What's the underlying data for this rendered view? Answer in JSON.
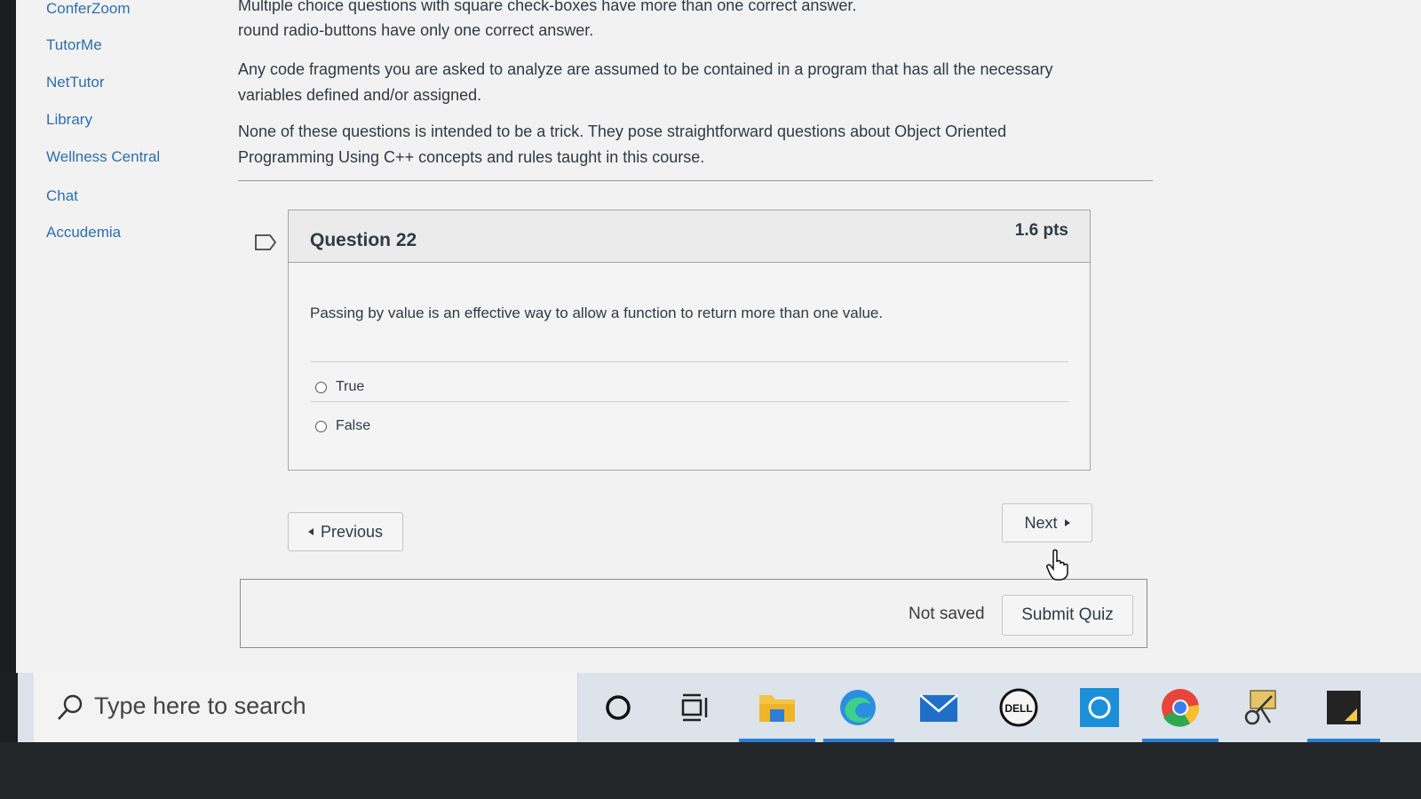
{
  "sidebar": {
    "items": [
      "ConferZoom",
      "TutorMe",
      "NetTutor",
      "Library",
      "Wellness Central",
      "Chat",
      "Accudemia"
    ]
  },
  "intro": {
    "para1_line1": "Multiple choice questions with square check-boxes have more than one correct answer.",
    "para1_line2": "round radio-buttons have only one correct answer.",
    "para2_line1": "Any code fragments you are asked to analyze are assumed to be contained in a program that has all the necessary",
    "para2_line2": "variables defined and/or assigned.",
    "para3_line1": "None of these questions is intended to be a trick.  They pose straightforward questions about Object Oriented",
    "para3_line2": "Programming Using C++  concepts and rules taught in this course."
  },
  "question": {
    "title": "Question 22",
    "points": "1.6 pts",
    "text": "Passing by value is an effective way to allow a function to return more than one value.",
    "answers": [
      "True",
      "False"
    ]
  },
  "nav": {
    "previous_label": "Previous",
    "next_label": "Next"
  },
  "footer": {
    "status": "Not saved",
    "submit_label": "Submit Quiz"
  },
  "taskbar": {
    "search_placeholder": "Type here to search",
    "icons": [
      "cortana-icon",
      "task-view-icon",
      "file-explorer-icon",
      "edge-icon",
      "mail-icon",
      "dell-icon",
      "app-icon",
      "chrome-icon",
      "snipping-tool-icon",
      "sticky-notes-icon"
    ]
  },
  "colors": {
    "link": "#2a6fae",
    "text": "#2d3b45",
    "taskbar": "#dce3ea",
    "accent": "#2d7fd6"
  }
}
